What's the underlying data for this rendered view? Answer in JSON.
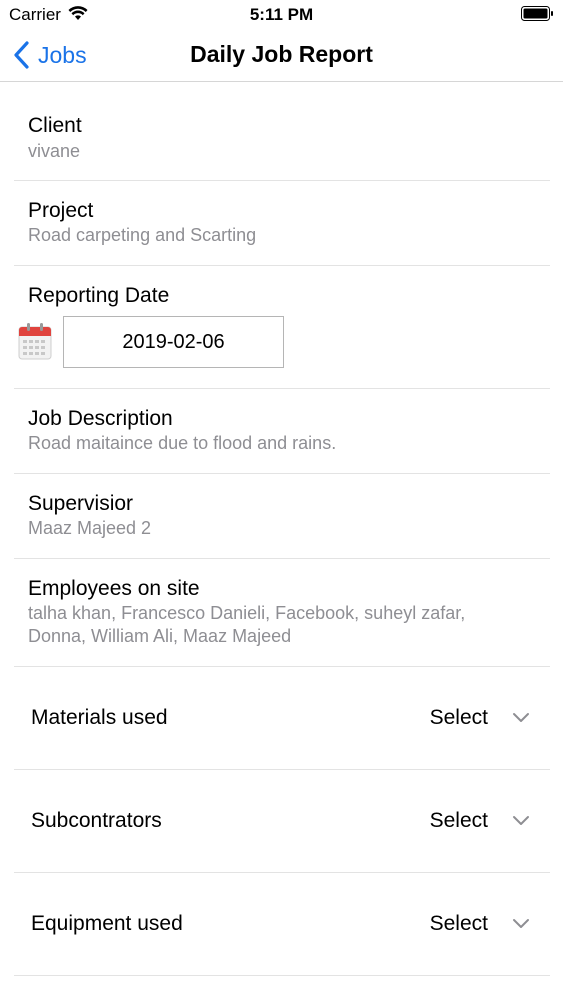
{
  "status_bar": {
    "carrier": "Carrier",
    "time": "5:11 PM"
  },
  "nav": {
    "back_label": "Jobs",
    "title": "Daily Job Report"
  },
  "fields": {
    "client": {
      "label": "Client",
      "value": "vivane"
    },
    "project": {
      "label": "Project",
      "value": "Road carpeting and Scarting"
    },
    "reporting_date": {
      "label": "Reporting Date",
      "value": "2019-02-06"
    },
    "job_description": {
      "label": "Job Description",
      "value": "Road maitaince due to flood and rains."
    },
    "supervisor": {
      "label": "Supervisior",
      "value": "Maaz Majeed 2"
    },
    "employees": {
      "label": "Employees on site",
      "line1": "talha khan, Francesco Danieli, Facebook, suheyl zafar,",
      "line2": "Donna, William Ali, Maaz Majeed"
    }
  },
  "selects": {
    "materials": {
      "label": "Materials used",
      "value": "Select"
    },
    "subcontractors": {
      "label": "Subcontrators",
      "value": "Select"
    },
    "equipment": {
      "label": "Equipment used",
      "value": "Select"
    }
  },
  "colors": {
    "accent": "#1a73e8",
    "secondary_text": "#8e8e93",
    "calendar_red": "#e0443e"
  },
  "icons": {
    "back": "chevron-left-icon",
    "calendar": "calendar-icon",
    "dropdown": "chevron-down-icon",
    "wifi": "wifi-icon",
    "battery": "battery-icon"
  }
}
